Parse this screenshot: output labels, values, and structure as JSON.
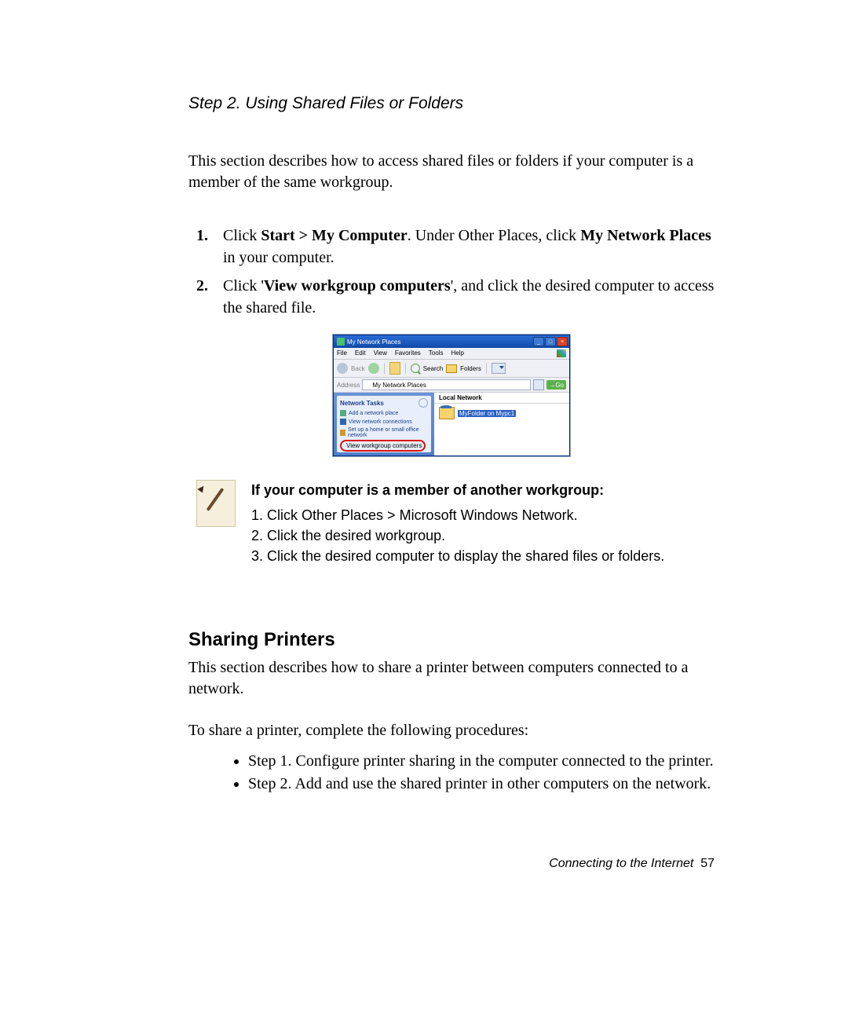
{
  "step_heading": "Step 2. Using Shared Files or Folders",
  "intro": "This section describes how to access shared files or folders if your computer is a member of the same workgroup.",
  "steps": {
    "s1": {
      "num": "1.",
      "pre": "Click ",
      "b1": "Start > My Computer",
      "mid": ". Under Other Places, click ",
      "b2": "My Network Places",
      "post": " in your computer."
    },
    "s2": {
      "num": "2.",
      "pre": "Click '",
      "b1": "View workgroup computers",
      "post": "', and click the desired computer to access the shared file."
    }
  },
  "screenshot": {
    "title": "My Network Places",
    "menu": {
      "file": "File",
      "edit": "Edit",
      "view": "View",
      "fav": "Favorites",
      "tools": "Tools",
      "help": "Help"
    },
    "toolbar": {
      "back": "Back",
      "search": "Search",
      "folders": "Folders"
    },
    "address": {
      "label": "Address",
      "value": "My Network Places",
      "go": "Go"
    },
    "panel": {
      "title": "Network Tasks",
      "items": [
        "Add a network place",
        "View network connections",
        "Set up a home or small office network"
      ],
      "highlight": "View workgroup computers"
    },
    "content": {
      "header": "Local Network",
      "item_label": "MyFolder on Mypc1"
    }
  },
  "note": {
    "title": "If your computer is a member of another workgroup:",
    "l1": "1. Click Other Places > Microsoft Windows Network.",
    "l2": "2. Click the desired workgroup.",
    "l3": "3. Click the desired computer to display the shared files or folders."
  },
  "section2": {
    "heading": "Sharing Printers",
    "p1": "This section describes how to share a printer between computers connected to a network.",
    "p2": "To share a printer, complete the following procedures:",
    "b1": "Step 1. Configure printer sharing in the computer connected to the printer.",
    "b2": "Step 2. Add and use the shared printer in other computers on the network."
  },
  "footer": {
    "label": "Connecting to the Internet",
    "page": "57"
  }
}
